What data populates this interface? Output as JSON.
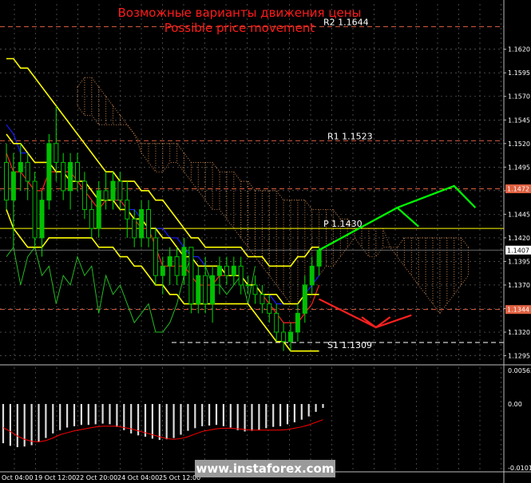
{
  "title_ru": "Возможные варианты движения цены",
  "title_en": "Possible price movement",
  "watermark": "www.instaforex.com",
  "colors": {
    "bg": "#000000",
    "grid": "#cfcfcf",
    "up": "#00c000",
    "down": "#007a00",
    "wick": "#00dd00",
    "bollinger": "#ffff00",
    "kijun": "#1a1aff",
    "tenkan": "#ff2020",
    "chikou": "#22bb22",
    "kumo": "#f0a060",
    "level": "#e06040",
    "pivot": "#ffff00",
    "current": "#ffffff",
    "arrow_up": "#00ff00",
    "arrow_down": "#ff2020",
    "macd_hist": "#dddddd",
    "macd_signal": "#ff0000",
    "text": "#ffffff"
  },
  "chart_data": {
    "type": "candlestick",
    "symbol_note": "EURUSD H4",
    "y_ticks": [
      "1.1620",
      "1.1595",
      "1.1570",
      "1.1545",
      "1.1520",
      "1.1495",
      "1.1470",
      "1.1445",
      "1.1420",
      "1.1395",
      "1.1370",
      "1.1345",
      "1.1320",
      "1.1295"
    ],
    "ylim": [
      1.1287,
      1.1668
    ],
    "x_ticks": [
      "Oct 04:00",
      "19 Oct 12:00",
      "22 Oct 20:00",
      "24 Oct 04:00",
      "25 Oct 12:00"
    ],
    "levels": [
      {
        "label": "R2 1.1644",
        "value": 1.1644
      },
      {
        "label": "R1 1.1523",
        "value": 1.1523
      },
      {
        "label": "P 1.1430",
        "value": 1.143
      },
      {
        "label": "S1 1.1309",
        "value": 1.1309
      }
    ],
    "tag_labels": [
      "1.1472",
      "1.1407",
      "1.1344"
    ],
    "tag_values": [
      1.1472,
      1.1407,
      1.1344
    ],
    "current_price": 1.1407,
    "candles": [
      [
        1.15,
        1.152,
        1.145,
        1.146
      ],
      [
        1.146,
        1.151,
        1.141,
        1.149
      ],
      [
        1.149,
        1.152,
        1.147,
        1.15
      ],
      [
        1.15,
        1.151,
        1.146,
        1.148
      ],
      [
        1.148,
        1.149,
        1.141,
        1.142
      ],
      [
        1.142,
        1.147,
        1.14,
        1.146
      ],
      [
        1.146,
        1.153,
        1.145,
        1.152
      ],
      [
        1.152,
        1.156,
        1.148,
        1.15
      ],
      [
        1.15,
        1.151,
        1.146,
        1.147
      ],
      [
        1.147,
        1.151,
        1.145,
        1.15
      ],
      [
        1.15,
        1.151,
        1.147,
        1.148
      ],
      [
        1.148,
        1.149,
        1.144,
        1.145
      ],
      [
        1.145,
        1.146,
        1.142,
        1.143
      ],
      [
        1.143,
        1.148,
        1.142,
        1.147
      ],
      [
        1.147,
        1.149,
        1.145,
        1.146
      ],
      [
        1.146,
        1.149,
        1.145,
        1.148
      ],
      [
        1.148,
        1.149,
        1.145,
        1.146
      ],
      [
        1.146,
        1.148,
        1.142,
        1.144
      ],
      [
        1.144,
        1.145,
        1.141,
        1.142
      ],
      [
        1.142,
        1.146,
        1.141,
        1.145
      ],
      [
        1.145,
        1.146,
        1.141,
        1.142
      ],
      [
        1.142,
        1.143,
        1.137,
        1.138
      ],
      [
        1.138,
        1.14,
        1.136,
        1.139
      ],
      [
        1.139,
        1.141,
        1.137,
        1.14
      ],
      [
        1.14,
        1.141,
        1.137,
        1.138
      ],
      [
        1.138,
        1.142,
        1.137,
        1.141
      ],
      [
        1.141,
        1.141,
        1.134,
        1.135
      ],
      [
        1.135,
        1.139,
        1.134,
        1.138
      ],
      [
        1.138,
        1.14,
        1.134,
        1.135
      ],
      [
        1.135,
        1.139,
        1.133,
        1.138
      ],
      [
        1.138,
        1.14,
        1.136,
        1.139
      ],
      [
        1.139,
        1.14,
        1.137,
        1.138
      ],
      [
        1.138,
        1.14,
        1.137,
        1.139
      ],
      [
        1.139,
        1.14,
        1.136,
        1.137
      ],
      [
        1.137,
        1.138,
        1.136,
        1.137
      ],
      [
        1.137,
        1.138,
        1.135,
        1.136
      ],
      [
        1.136,
        1.137,
        1.134,
        1.135
      ],
      [
        1.135,
        1.136,
        1.133,
        1.134
      ],
      [
        1.134,
        1.135,
        1.131,
        1.132
      ],
      [
        1.132,
        1.133,
        1.13,
        1.131
      ],
      [
        1.131,
        1.133,
        1.13,
        1.132
      ],
      [
        1.132,
        1.135,
        1.131,
        1.134
      ],
      [
        1.134,
        1.138,
        1.133,
        1.137
      ],
      [
        1.137,
        1.14,
        1.136,
        1.139
      ],
      [
        1.139,
        1.141,
        1.138,
        1.1407
      ]
    ],
    "bollinger_upper": [
      1.161,
      1.161,
      1.16,
      1.16,
      1.159,
      1.158,
      1.157,
      1.156,
      1.155,
      1.154,
      1.153,
      1.152,
      1.151,
      1.15,
      1.149,
      1.149,
      1.148,
      1.148,
      1.148,
      1.147,
      1.147,
      1.146,
      1.146,
      1.145,
      1.144,
      1.143,
      1.142,
      1.142,
      1.141,
      1.141,
      1.141,
      1.141,
      1.141,
      1.141,
      1.14,
      1.14,
      1.14,
      1.139,
      1.139,
      1.139,
      1.139,
      1.14,
      1.14,
      1.141,
      1.141
    ],
    "bollinger_middle": [
      1.153,
      1.152,
      1.152,
      1.151,
      1.15,
      1.15,
      1.15,
      1.149,
      1.149,
      1.148,
      1.148,
      1.148,
      1.147,
      1.146,
      1.146,
      1.146,
      1.145,
      1.145,
      1.144,
      1.144,
      1.143,
      1.143,
      1.142,
      1.142,
      1.141,
      1.14,
      1.14,
      1.139,
      1.139,
      1.139,
      1.139,
      1.138,
      1.138,
      1.138,
      1.137,
      1.137,
      1.136,
      1.136,
      1.136,
      1.135,
      1.135,
      1.135,
      1.136,
      1.136,
      1.136
    ],
    "bollinger_lower": [
      1.145,
      1.143,
      1.142,
      1.141,
      1.141,
      1.141,
      1.142,
      1.142,
      1.142,
      1.142,
      1.142,
      1.142,
      1.142,
      1.141,
      1.141,
      1.141,
      1.14,
      1.14,
      1.139,
      1.139,
      1.138,
      1.137,
      1.137,
      1.136,
      1.136,
      1.135,
      1.135,
      1.135,
      1.135,
      1.135,
      1.135,
      1.135,
      1.135,
      1.135,
      1.135,
      1.134,
      1.133,
      1.132,
      1.131,
      1.131,
      1.13,
      1.13,
      1.13,
      1.13,
      1.13
    ],
    "kijun": [
      1.154,
      1.153,
      1.151,
      1.151,
      1.15,
      1.15,
      1.15,
      1.149,
      1.149,
      1.149,
      1.148,
      1.148,
      1.147,
      1.146,
      1.146,
      1.146,
      1.146,
      1.145,
      1.145,
      1.144,
      1.143,
      1.143,
      1.143,
      1.142,
      1.142,
      1.141,
      1.14,
      1.14,
      1.139,
      1.139,
      1.139,
      1.138,
      1.138,
      1.138,
      1.137,
      1.137,
      1.136,
      1.136,
      1.135,
      1.135,
      1.135,
      1.135,
      1.136,
      1.137,
      1.138
    ],
    "tenkan": [
      1.151,
      1.149,
      1.149,
      1.148,
      1.147,
      1.147,
      1.149,
      1.149,
      1.149,
      1.149,
      1.148,
      1.147,
      1.146,
      1.145,
      1.146,
      1.146,
      1.146,
      1.145,
      1.144,
      1.143,
      1.143,
      1.141,
      1.139,
      1.139,
      1.139,
      1.139,
      1.138,
      1.137,
      1.137,
      1.137,
      1.138,
      1.138,
      1.138,
      1.138,
      1.137,
      1.137,
      1.136,
      1.135,
      1.134,
      1.133,
      1.133,
      1.133,
      1.134,
      1.135,
      1.137
    ],
    "chikou": [
      1.14,
      1.141,
      1.137,
      1.14,
      1.141,
      1.138,
      1.139,
      1.135,
      1.138,
      1.137,
      1.14,
      1.138,
      1.139,
      1.134,
      1.138,
      1.136,
      1.137,
      1.135,
      1.133,
      1.134,
      1.135,
      1.132,
      1.132,
      1.133,
      1.135,
      1.138,
      1.14,
      1.139,
      1.139,
      1.137,
      1.137,
      1.136,
      1.137,
      1.138,
      1.135,
      1.139
    ],
    "kumo_a": [
      1.158,
      1.159,
      1.159,
      1.158,
      1.157,
      1.156,
      1.155,
      1.154,
      1.153,
      1.151,
      1.15,
      1.149,
      1.149,
      1.15,
      1.15,
      1.149,
      1.148,
      1.147,
      1.146,
      1.145,
      1.145,
      1.144,
      1.143,
      1.142,
      1.141,
      1.14,
      1.139,
      1.138,
      1.137,
      1.136,
      1.135,
      1.135,
      1.136,
      1.137,
      1.138,
      1.139,
      1.139,
      1.14,
      1.141,
      1.142,
      1.141,
      1.14,
      1.14,
      1.141,
      1.141,
      1.141,
      1.142,
      1.142,
      1.142,
      1.142,
      1.142,
      1.142,
      1.142,
      1.142,
      1.142,
      1.141
    ],
    "kumo_b": [
      1.156,
      1.155,
      1.155,
      1.154,
      1.154,
      1.154,
      1.154,
      1.154,
      1.153,
      1.152,
      1.152,
      1.152,
      1.152,
      1.152,
      1.152,
      1.151,
      1.15,
      1.15,
      1.15,
      1.15,
      1.149,
      1.149,
      1.149,
      1.148,
      1.148,
      1.147,
      1.147,
      1.147,
      1.147,
      1.146,
      1.146,
      1.146,
      1.146,
      1.145,
      1.145,
      1.145,
      1.145,
      1.144,
      1.144,
      1.143,
      1.143,
      1.143,
      1.143,
      1.143,
      1.141,
      1.14,
      1.139,
      1.138,
      1.137,
      1.136,
      1.135,
      1.134,
      1.135,
      1.136,
      1.137,
      1.138
    ],
    "forecast_up": [
      [
        44,
        1.1407
      ],
      [
        55,
        1.1452
      ],
      [
        58,
        1.1432
      ],
      [
        55,
        1.1452
      ],
      [
        63,
        1.1475
      ],
      [
        66,
        1.1452
      ],
      [
        63,
        1.1475
      ]
    ],
    "forecast_down": [
      [
        44,
        1.1355
      ],
      [
        52,
        1.1325
      ],
      [
        57,
        1.1338
      ]
    ],
    "macd": {
      "yticks": [
        "0.00562",
        "0.00",
        "-0.01013"
      ],
      "ylim": [
        -0.01013,
        0.00562
      ],
      "histogram": [
        -0.006,
        -0.0064,
        -0.0066,
        -0.0065,
        -0.0063,
        -0.0058,
        -0.0052,
        -0.0045,
        -0.004,
        -0.0036,
        -0.0034,
        -0.0032,
        -0.0032,
        -0.0031,
        -0.003,
        -0.0031,
        -0.0035,
        -0.004,
        -0.0045,
        -0.0048,
        -0.005,
        -0.0053,
        -0.0055,
        -0.0054,
        -0.0052,
        -0.0047,
        -0.0041,
        -0.0037,
        -0.0034,
        -0.0033,
        -0.0032,
        -0.0034,
        -0.0036,
        -0.004,
        -0.0042,
        -0.0041,
        -0.004,
        -0.0037,
        -0.0035,
        -0.0034,
        -0.0031,
        -0.0028,
        -0.0024,
        -0.0019,
        -0.0012,
        -0.0006
      ],
      "signal": [
        -0.0036,
        -0.0042,
        -0.0049,
        -0.0054,
        -0.0057,
        -0.0058,
        -0.0056,
        -0.0052,
        -0.0047,
        -0.0044,
        -0.0041,
        -0.0039,
        -0.0037,
        -0.0035,
        -0.0034,
        -0.0034,
        -0.0034,
        -0.0036,
        -0.0038,
        -0.0041,
        -0.0044,
        -0.0047,
        -0.005,
        -0.0053,
        -0.0054,
        -0.0053,
        -0.005,
        -0.0046,
        -0.0042,
        -0.004,
        -0.0038,
        -0.0037,
        -0.0037,
        -0.0038,
        -0.0039,
        -0.004,
        -0.004,
        -0.004,
        -0.004,
        -0.004,
        -0.0039,
        -0.0037,
        -0.0035,
        -0.0032,
        -0.0028,
        -0.0024
      ]
    }
  }
}
